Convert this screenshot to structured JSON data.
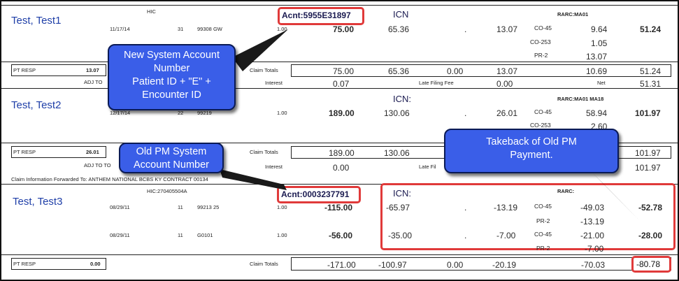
{
  "row1": {
    "name": "Test, Test1",
    "hic": "HIC",
    "acnt": "Acnt:5955E31897",
    "icn": "ICN",
    "rarc": "RARC:MA01",
    "service": {
      "date": "11/17/14",
      "pos": "31",
      "code": "99308 GW",
      "units": "1.00",
      "billed": "75.00",
      "allowed": "65.36",
      "dot": ".",
      "coins": "13.07"
    },
    "adjustments": [
      {
        "code": "CO-45",
        "amount": "9.64"
      },
      {
        "code": "CO-253",
        "amount": "1.05"
      },
      {
        "code": "PR-2",
        "amount": "13.07"
      }
    ],
    "paid": "51.24",
    "pt_resp_label": "PT RESP",
    "pt_resp": "13.07",
    "claim_totals_label": "Claim Totals",
    "totals": [
      "75.00",
      "65.36",
      "0.00",
      "13.07",
      "10.69",
      "51.24"
    ],
    "adj_label": "ADJ TO",
    "interest_label": "Interest",
    "interest": "0.07",
    "late_fee_label": "Late Filing Fee",
    "late_fee": "0.00",
    "net_label": "Net",
    "net": "51.31"
  },
  "row2": {
    "name": "Test, Test2",
    "icn": "ICN:",
    "rarc": "RARC:MA01 MA18",
    "service": {
      "date": "12/17/14",
      "pos": "22",
      "code": "99219",
      "units": "1.00",
      "billed": "189.00",
      "allowed": "130.06",
      "dot": ".",
      "coins": "26.01"
    },
    "adjustment": {
      "code": "CO-45",
      "amount": "58.94"
    },
    "adjustment2": {
      "code": "CO-253",
      "amount": "2.60"
    },
    "paid": "101.97",
    "pt_resp_label": "PT RESP",
    "pt_resp": "26.01",
    "claim_totals_label": "Claim Totals",
    "totals": [
      "189.00",
      "130.06",
      "101.97"
    ],
    "adj_label": "ADJ TO TO",
    "interest_label": "Interest",
    "interest": "0.00",
    "late_fee_label": "Late Fil",
    "net": "101.97",
    "claim_forward": "Claim Information Forwarded To: ANTHEM NATIONAL BCBS KY CONTRACT 00134"
  },
  "row3": {
    "name": "Test, Test3",
    "hic": "HIC:270405504A",
    "acnt": "Acnt:0003237791",
    "icn": "ICN:",
    "rarc": "RARC:",
    "services": [
      {
        "date": "08/29/11",
        "pos": "11",
        "code": "99213 25",
        "units": "1.00",
        "billed": "-115.00",
        "allowed": "-65.97",
        "dot": ".",
        "coins": "-13.19",
        "adjustments": [
          {
            "code": "CO-45",
            "amount": "-49.03"
          },
          {
            "code": "PR-2",
            "amount": "-13.19"
          }
        ],
        "paid": "-52.78"
      },
      {
        "date": "08/29/11",
        "pos": "11",
        "code": "G0101",
        "units": "1.00",
        "billed": "-56.00",
        "allowed": "-35.00",
        "dot": ".",
        "coins": "-7.00",
        "adjustments": [
          {
            "code": "CO-45",
            "amount": "-21.00"
          },
          {
            "code": "PR-2",
            "amount": "-7.00"
          }
        ],
        "paid": "-28.00"
      }
    ],
    "pt_resp_label": "PT RESP",
    "pt_resp": "0.00",
    "claim_totals_label": "Claim Totals",
    "totals": [
      "-171.00",
      "-100.97",
      "0.00",
      "-20.19",
      "-70.03",
      "-80.78"
    ]
  },
  "callouts": {
    "new_system": [
      "New System Account",
      "Number",
      "Patient ID + \"E\" +",
      "Encounter ID"
    ],
    "old_pm": [
      "Old PM System",
      "Account Number"
    ],
    "takeback": [
      "Takeback of Old PM",
      "Payment."
    ]
  },
  "colors": {
    "callout_fill": "#3a5ee8",
    "callout_border": "#0a1a55",
    "highlight": "#e03a3a",
    "name_text": "#1f3fa8"
  }
}
